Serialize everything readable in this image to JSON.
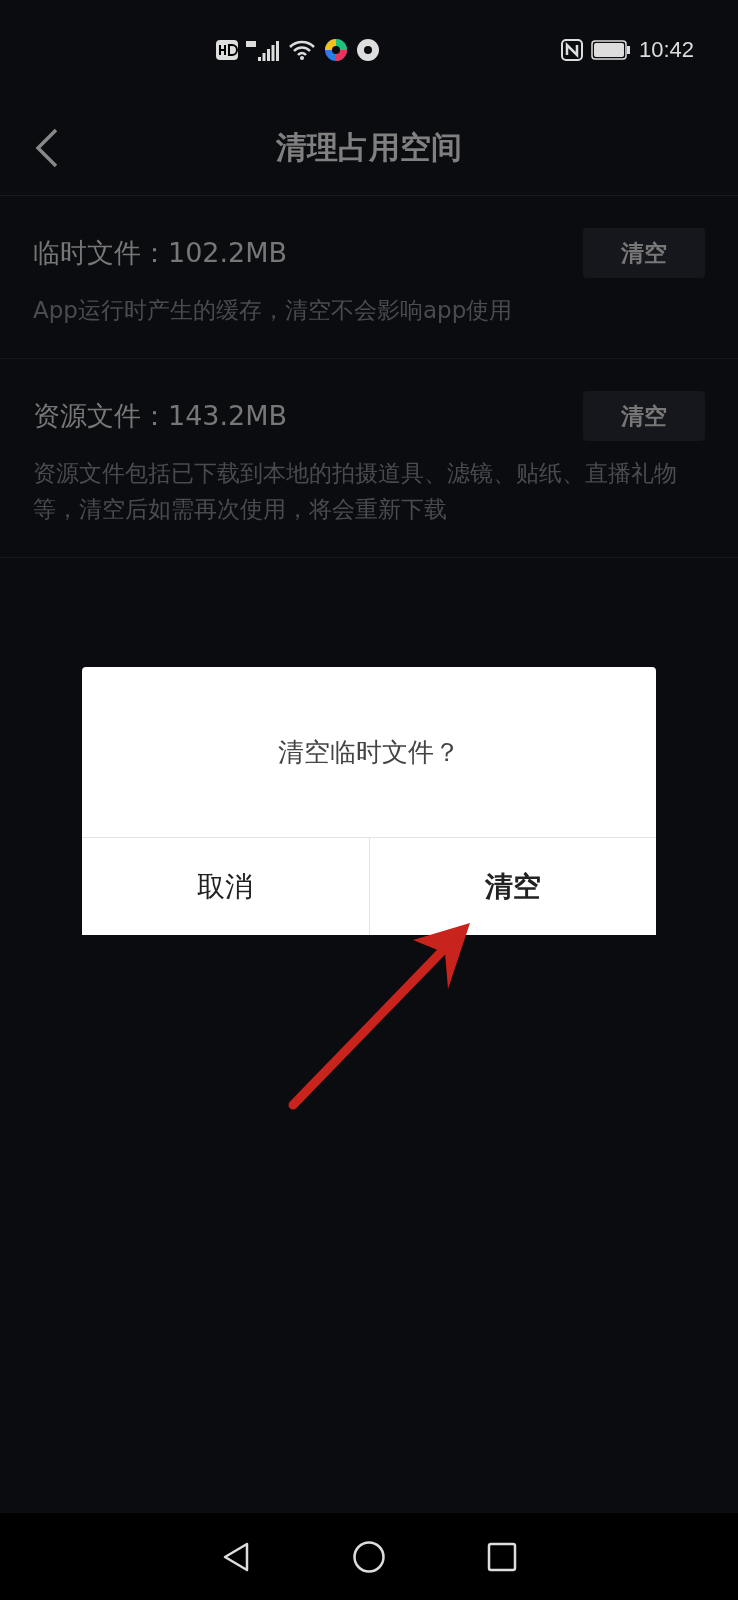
{
  "status_bar": {
    "time": "10:42"
  },
  "header": {
    "title": "清理占用空间"
  },
  "items": [
    {
      "title": "临时文件：102.2MB",
      "description": "App运行时产生的缓存，清空不会影响app使用",
      "button": "清空"
    },
    {
      "title": "资源文件：143.2MB",
      "description": "资源文件包括已下载到本地的拍摄道具、滤镜、贴纸、直播礼物等，清空后如需再次使用，将会重新下载",
      "button": "清空"
    }
  ],
  "dialog": {
    "message": "清空临时文件？",
    "buttons": [
      {
        "label": "取消",
        "emphasized": false
      },
      {
        "label": "清空",
        "emphasized": true
      }
    ]
  }
}
